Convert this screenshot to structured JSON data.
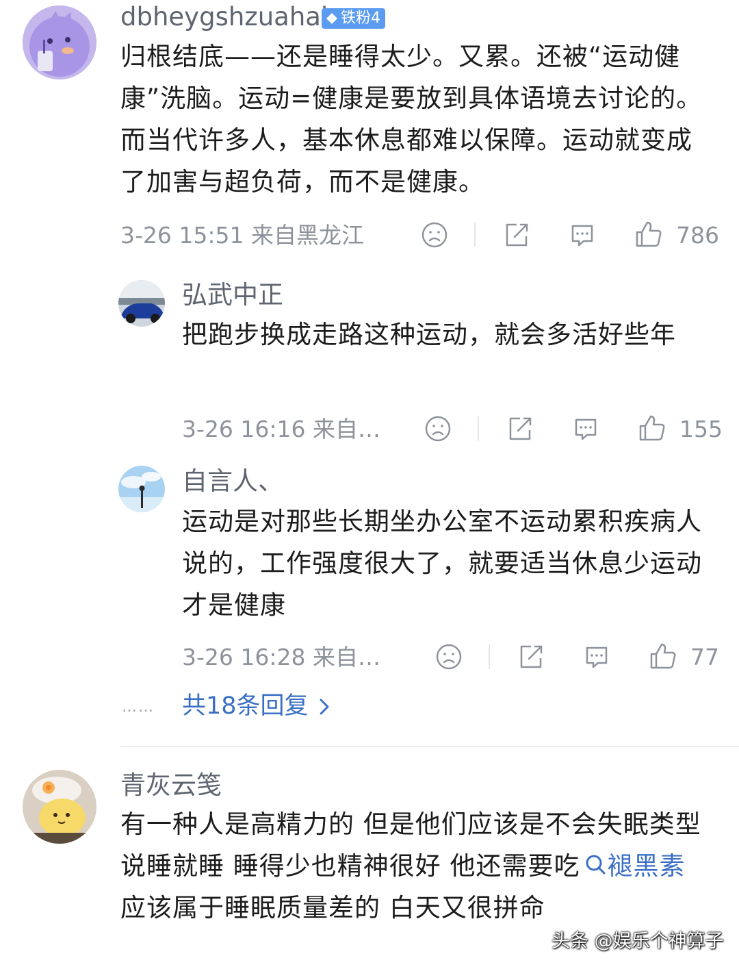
{
  "comments": [
    {
      "username": "dbheygshzuahah",
      "badge": "铁粉4",
      "text": "归根结底——还是睡得太少。又累。还被“运动健康”洗脑。运动=健康是要放到具体语境去讨论的。而当代许多人，基本休息都难以保障。运动就变成了加害与超负荷，而不是健康。",
      "meta": "3-26 15:51 来自黑龙江",
      "likes": "786",
      "avatar_icon": "purple-cartoon-avatar"
    },
    {
      "username": "弘武中正",
      "text": "把跑步换成走路这种运动，就会多活好些年",
      "meta": "3-26 16:16 来自…",
      "likes": "155",
      "avatar_icon": "blue-car-avatar"
    },
    {
      "username": "自言人、",
      "text": "运动是对那些长期坐办公室不运动累积疾病人说的，工作强度很大了，就要适当休息少运动才是健康",
      "meta": "3-26 16:28 来自…",
      "likes": "77",
      "avatar_icon": "sky-avatar"
    },
    {
      "username": "青灰云笺",
      "text_before": "有一种人是高精力的 但是他们应该是不会失眠类型 说睡就睡 睡得少也精神很好 他还需要吃",
      "link_text": "褪黑素",
      "text_after": " 应该属于睡眠质量差的 白天又很拼命",
      "avatar_icon": "plush-toy-avatar"
    }
  ],
  "replies": {
    "dots": "……",
    "link": "共18条回复"
  },
  "watermark": "头条 @娱乐个神算子",
  "colors": {
    "link": "#3a6fc4",
    "badge": "#5b9cf0",
    "meta": "#8e939b",
    "text": "#1c1c1c"
  }
}
